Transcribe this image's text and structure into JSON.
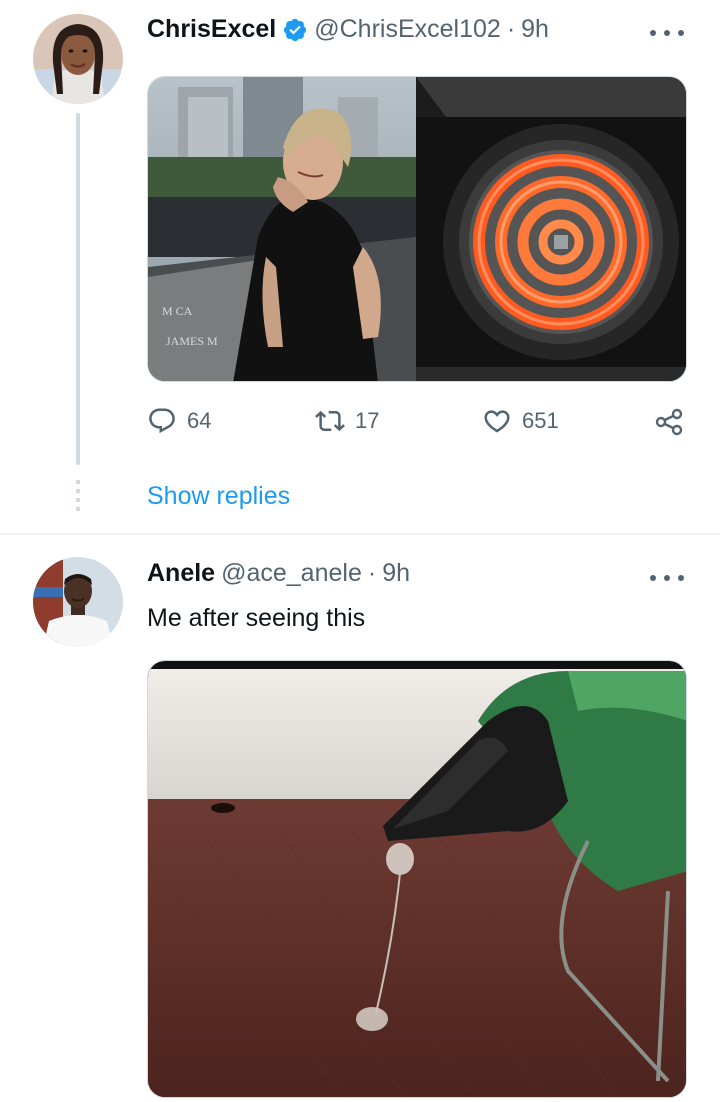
{
  "tweet1": {
    "author_name": "ChrisExcel",
    "handle": "@ChrisExcel102",
    "separator": "·",
    "time": "9h",
    "verified": true,
    "media": [
      "crying-woman-photo",
      "electric-stove-coil-photo"
    ],
    "actions": {
      "replies": "64",
      "retweets": "17",
      "likes": "651"
    },
    "show_replies_label": "Show replies"
  },
  "tweet2": {
    "author_name": "Anele",
    "handle": "@ace_anele",
    "separator": "·",
    "time": "9h",
    "text": "Me after seeing this",
    "media": [
      "glue-gun-drip-photo"
    ]
  },
  "icons": {
    "reply": "reply-icon",
    "retweet": "retweet-icon",
    "like": "heart-icon",
    "share": "share-icon",
    "more": "more-icon",
    "verified": "verified-badge-icon"
  },
  "colors": {
    "accent": "#1d9bf0",
    "secondary_text": "#536471",
    "thread_line": "#cfd9de"
  }
}
